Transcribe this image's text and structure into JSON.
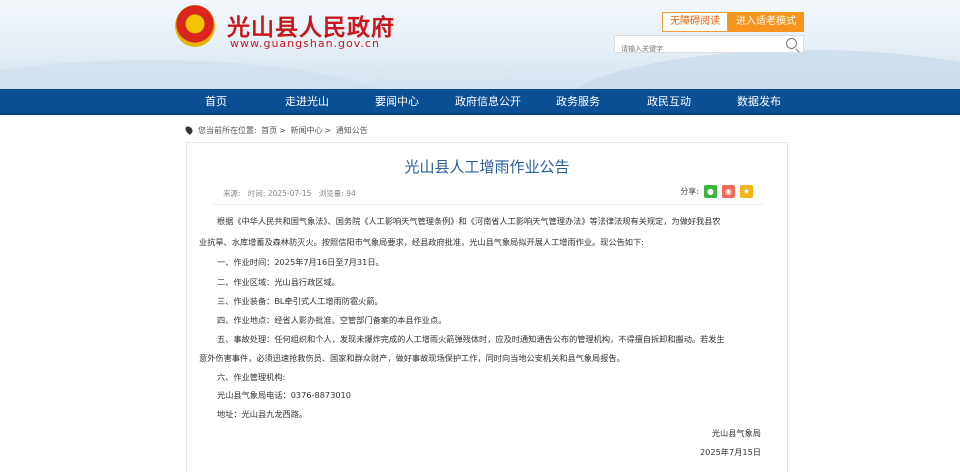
{
  "header": {
    "site_title": "光山县人民政府",
    "site_url": "www.guangshan.gov.cn",
    "accessibility_label": "无障碍阅读",
    "elder_mode_label": "进入适老模式",
    "search_placeholder": "请输入关键字"
  },
  "nav": [
    "首页",
    "走进光山",
    "要闻中心",
    "政府信息公开",
    "政务服务",
    "政民互动",
    "数据发布"
  ],
  "breadcrumb": {
    "label": "您当前所在位置:",
    "items": [
      "首页",
      "新闻中心",
      "通知公告"
    ],
    "separator": ">"
  },
  "article": {
    "title": "光山县人工增雨作业公告",
    "source": "来源:",
    "time": "时间: 2025-07-15",
    "views": "浏览量: 94",
    "share_label": "分享:",
    "paragraphs": [
      "根据《中华人民共和国气象法》、国务院《人工影响天气管理条例》和《河南省人工影响天气管理办法》等法律法规有关规定，为做好我县农",
      "业抗旱、水库增蓄及森林防灭火。按照信阳市气象局要求，经县政府批准，光山县气象局拟开展人工增雨作业。现公告如下:",
      "一、作业时间：2025年7月16日至7月31日。",
      "二、作业区域：光山县行政区域。",
      "三、作业装备：BL牵引式人工增雨防雹火箭。",
      "四、作业地点：经省人影办批准、空管部门备案的本县作业点。",
      "五、事故处理：任何组织和个人，发现未爆炸完成的人工增雨火箭弹残体时，应及时通知通告公布的管理机构，不得擅自拆卸和搬动。若发生",
      "意外伤害事件，必须迅速抢救伤员、国家和群众财产，做好事故现场保护工作，同时向当地公安机关和县气象局报告。",
      "六、作业管理机构:",
      "光山县气象局电话：0376-8873010",
      "地址：光山县九龙西路。"
    ],
    "signature": "光山县气象局",
    "date": "2025年7月15日"
  }
}
